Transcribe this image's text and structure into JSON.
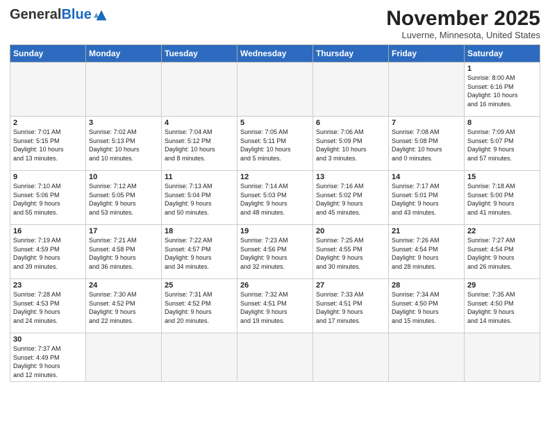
{
  "header": {
    "logo_general": "General",
    "logo_blue": "Blue",
    "month_title": "November 2025",
    "location": "Luverne, Minnesota, United States"
  },
  "days_of_week": [
    "Sunday",
    "Monday",
    "Tuesday",
    "Wednesday",
    "Thursday",
    "Friday",
    "Saturday"
  ],
  "weeks": [
    [
      {
        "day": "",
        "info": ""
      },
      {
        "day": "",
        "info": ""
      },
      {
        "day": "",
        "info": ""
      },
      {
        "day": "",
        "info": ""
      },
      {
        "day": "",
        "info": ""
      },
      {
        "day": "",
        "info": ""
      },
      {
        "day": "1",
        "info": "Sunrise: 8:00 AM\nSunset: 6:16 PM\nDaylight: 10 hours\nand 16 minutes."
      }
    ],
    [
      {
        "day": "2",
        "info": "Sunrise: 7:01 AM\nSunset: 5:15 PM\nDaylight: 10 hours\nand 13 minutes."
      },
      {
        "day": "3",
        "info": "Sunrise: 7:02 AM\nSunset: 5:13 PM\nDaylight: 10 hours\nand 10 minutes."
      },
      {
        "day": "4",
        "info": "Sunrise: 7:04 AM\nSunset: 5:12 PM\nDaylight: 10 hours\nand 8 minutes."
      },
      {
        "day": "5",
        "info": "Sunrise: 7:05 AM\nSunset: 5:11 PM\nDaylight: 10 hours\nand 5 minutes."
      },
      {
        "day": "6",
        "info": "Sunrise: 7:06 AM\nSunset: 5:09 PM\nDaylight: 10 hours\nand 3 minutes."
      },
      {
        "day": "7",
        "info": "Sunrise: 7:08 AM\nSunset: 5:08 PM\nDaylight: 10 hours\nand 0 minutes."
      },
      {
        "day": "8",
        "info": "Sunrise: 7:09 AM\nSunset: 5:07 PM\nDaylight: 9 hours\nand 57 minutes."
      }
    ],
    [
      {
        "day": "9",
        "info": "Sunrise: 7:10 AM\nSunset: 5:06 PM\nDaylight: 9 hours\nand 55 minutes."
      },
      {
        "day": "10",
        "info": "Sunrise: 7:12 AM\nSunset: 5:05 PM\nDaylight: 9 hours\nand 53 minutes."
      },
      {
        "day": "11",
        "info": "Sunrise: 7:13 AM\nSunset: 5:04 PM\nDaylight: 9 hours\nand 50 minutes."
      },
      {
        "day": "12",
        "info": "Sunrise: 7:14 AM\nSunset: 5:03 PM\nDaylight: 9 hours\nand 48 minutes."
      },
      {
        "day": "13",
        "info": "Sunrise: 7:16 AM\nSunset: 5:02 PM\nDaylight: 9 hours\nand 45 minutes."
      },
      {
        "day": "14",
        "info": "Sunrise: 7:17 AM\nSunset: 5:01 PM\nDaylight: 9 hours\nand 43 minutes."
      },
      {
        "day": "15",
        "info": "Sunrise: 7:18 AM\nSunset: 5:00 PM\nDaylight: 9 hours\nand 41 minutes."
      }
    ],
    [
      {
        "day": "16",
        "info": "Sunrise: 7:19 AM\nSunset: 4:59 PM\nDaylight: 9 hours\nand 39 minutes."
      },
      {
        "day": "17",
        "info": "Sunrise: 7:21 AM\nSunset: 4:58 PM\nDaylight: 9 hours\nand 36 minutes."
      },
      {
        "day": "18",
        "info": "Sunrise: 7:22 AM\nSunset: 4:57 PM\nDaylight: 9 hours\nand 34 minutes."
      },
      {
        "day": "19",
        "info": "Sunrise: 7:23 AM\nSunset: 4:56 PM\nDaylight: 9 hours\nand 32 minutes."
      },
      {
        "day": "20",
        "info": "Sunrise: 7:25 AM\nSunset: 4:55 PM\nDaylight: 9 hours\nand 30 minutes."
      },
      {
        "day": "21",
        "info": "Sunrise: 7:26 AM\nSunset: 4:54 PM\nDaylight: 9 hours\nand 28 minutes."
      },
      {
        "day": "22",
        "info": "Sunrise: 7:27 AM\nSunset: 4:54 PM\nDaylight: 9 hours\nand 26 minutes."
      }
    ],
    [
      {
        "day": "23",
        "info": "Sunrise: 7:28 AM\nSunset: 4:53 PM\nDaylight: 9 hours\nand 24 minutes."
      },
      {
        "day": "24",
        "info": "Sunrise: 7:30 AM\nSunset: 4:52 PM\nDaylight: 9 hours\nand 22 minutes."
      },
      {
        "day": "25",
        "info": "Sunrise: 7:31 AM\nSunset: 4:52 PM\nDaylight: 9 hours\nand 20 minutes."
      },
      {
        "day": "26",
        "info": "Sunrise: 7:32 AM\nSunset: 4:51 PM\nDaylight: 9 hours\nand 19 minutes."
      },
      {
        "day": "27",
        "info": "Sunrise: 7:33 AM\nSunset: 4:51 PM\nDaylight: 9 hours\nand 17 minutes."
      },
      {
        "day": "28",
        "info": "Sunrise: 7:34 AM\nSunset: 4:50 PM\nDaylight: 9 hours\nand 15 minutes."
      },
      {
        "day": "29",
        "info": "Sunrise: 7:35 AM\nSunset: 4:50 PM\nDaylight: 9 hours\nand 14 minutes."
      }
    ],
    [
      {
        "day": "30",
        "info": "Sunrise: 7:37 AM\nSunset: 4:49 PM\nDaylight: 9 hours\nand 12 minutes."
      },
      {
        "day": "",
        "info": ""
      },
      {
        "day": "",
        "info": ""
      },
      {
        "day": "",
        "info": ""
      },
      {
        "day": "",
        "info": ""
      },
      {
        "day": "",
        "info": ""
      },
      {
        "day": "",
        "info": ""
      }
    ]
  ]
}
